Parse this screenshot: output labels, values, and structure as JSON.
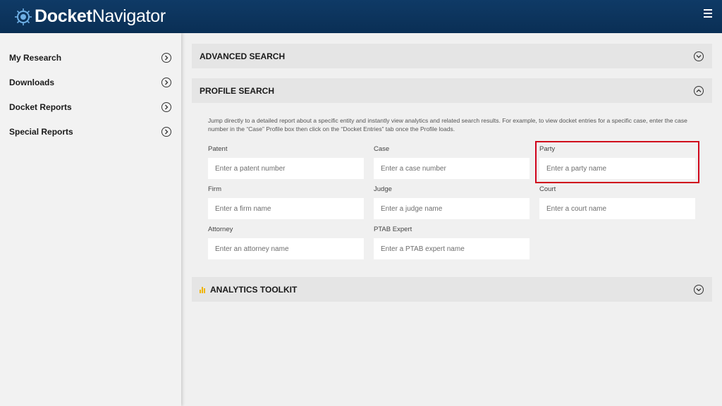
{
  "header": {
    "brand_bold": "Docket",
    "brand_light": "Navigator",
    "menu_icon": "hamburger-icon"
  },
  "sidebar": {
    "items": [
      {
        "label": "My Research",
        "icon": "chevron-right-circle-icon"
      },
      {
        "label": "Downloads",
        "icon": "chevron-right-circle-icon"
      },
      {
        "label": "Docket Reports",
        "icon": "chevron-right-circle-icon"
      },
      {
        "label": "Special Reports",
        "icon": "chevron-right-circle-icon"
      }
    ]
  },
  "advanced_search": {
    "title": "ADVANCED SEARCH",
    "state": "collapsed"
  },
  "profile_search": {
    "title": "PROFILE SEARCH",
    "state": "expanded",
    "description": "Jump directly to a detailed report about a specific entity and instantly view analytics and related search results. For example, to view docket entries for a specific case, enter the case number in the “Case” Profile box then click on the “Docket Entries” tab once the Profile loads.",
    "fields": [
      {
        "label": "Patent",
        "placeholder": "Enter a patent number"
      },
      {
        "label": "Case",
        "placeholder": "Enter a case number"
      },
      {
        "label": "Party",
        "placeholder": "Enter a party name",
        "highlighted": true
      },
      {
        "label": "Firm",
        "placeholder": "Enter a firm name"
      },
      {
        "label": "Judge",
        "placeholder": "Enter a judge name"
      },
      {
        "label": "Court",
        "placeholder": "Enter a court name"
      },
      {
        "label": "Attorney",
        "placeholder": "Enter an attorney name"
      },
      {
        "label": "PTAB Expert",
        "placeholder": "Enter a PTAB expert name"
      }
    ]
  },
  "analytics_toolkit": {
    "title": "ANALYTICS TOOLKIT",
    "icon": "bar-chart-icon",
    "state": "collapsed"
  },
  "colors": {
    "header_bg": "#0a2f55",
    "highlight": "#d0021b",
    "analytics_icon": "#f0b400"
  }
}
